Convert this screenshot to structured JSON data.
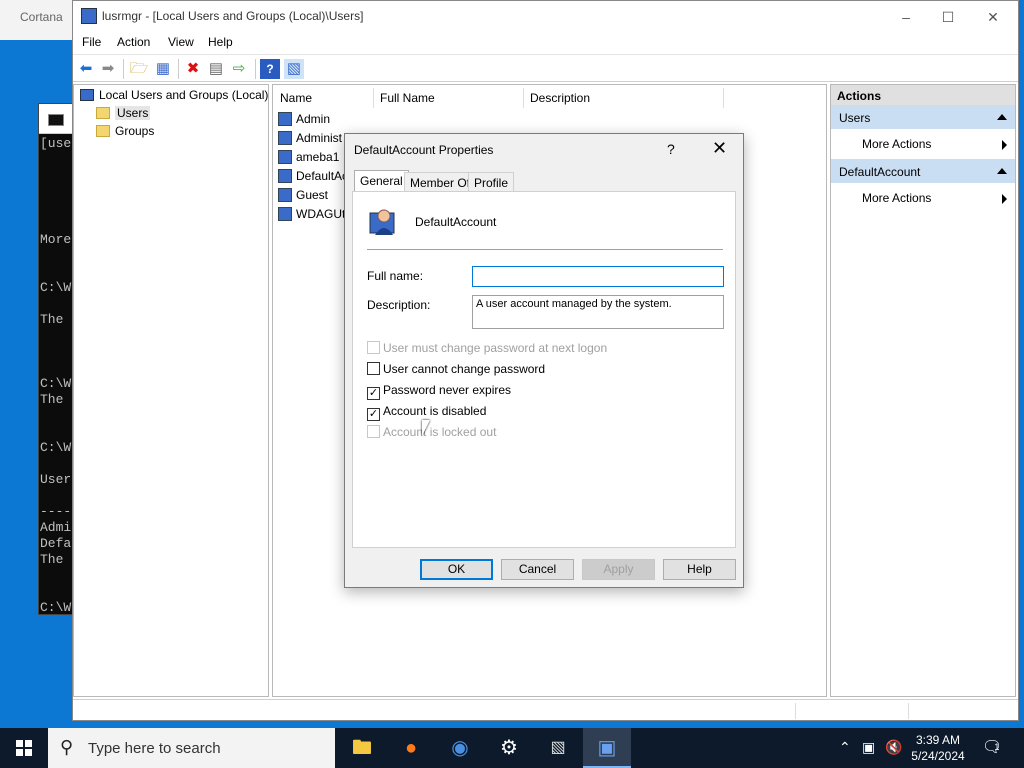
{
  "cortana": {
    "label": "Cortana"
  },
  "console": {
    "lines": [
      "[use",
      "More",
      "C:\\W",
      "The",
      "C:\\W",
      "The",
      "C:\\W",
      "User",
      "----",
      "Admi",
      "Defa",
      "The",
      "C:\\W"
    ]
  },
  "mmc": {
    "title": "lusrmgr - [Local Users and Groups (Local)\\Users]",
    "menu": [
      "File",
      "Action",
      "View",
      "Help"
    ],
    "tree": {
      "root": "Local Users and Groups (Local)",
      "children": [
        "Users",
        "Groups"
      ]
    },
    "list": {
      "columns": [
        "Name",
        "Full Name",
        "Description"
      ],
      "rows": [
        "Admin",
        "Administ",
        "ameba1",
        "DefaultAc",
        "Guest",
        "WDAGUti"
      ]
    },
    "actions": {
      "header": "Actions",
      "groups": [
        {
          "title": "Users",
          "item": "More Actions"
        },
        {
          "title": "DefaultAccount",
          "item": "More Actions"
        }
      ]
    }
  },
  "dialog": {
    "title": "DefaultAccount Properties",
    "help_glyph": "?",
    "tabs": [
      "General",
      "Member Of",
      "Profile"
    ],
    "account_name": "DefaultAccount",
    "full_name_label": "Full name:",
    "full_name_value": "",
    "description_label": "Description:",
    "description_value": "A user account managed by the system.",
    "checkboxes": [
      {
        "label": "User must change password at next logon",
        "checked": false,
        "disabled": true
      },
      {
        "label": "User cannot change password",
        "checked": false,
        "disabled": false
      },
      {
        "label": "Password never expires",
        "checked": true,
        "disabled": false
      },
      {
        "label": "Account is disabled",
        "checked": true,
        "disabled": false
      },
      {
        "label": "Account is locked out",
        "checked": false,
        "disabled": true
      }
    ],
    "buttons": {
      "ok": "OK",
      "cancel": "Cancel",
      "apply": "Apply",
      "help": "Help"
    }
  },
  "taskbar": {
    "search_placeholder": "Type here to search",
    "time": "3:39 AM",
    "date": "5/24/2024",
    "notification_count": "1"
  }
}
